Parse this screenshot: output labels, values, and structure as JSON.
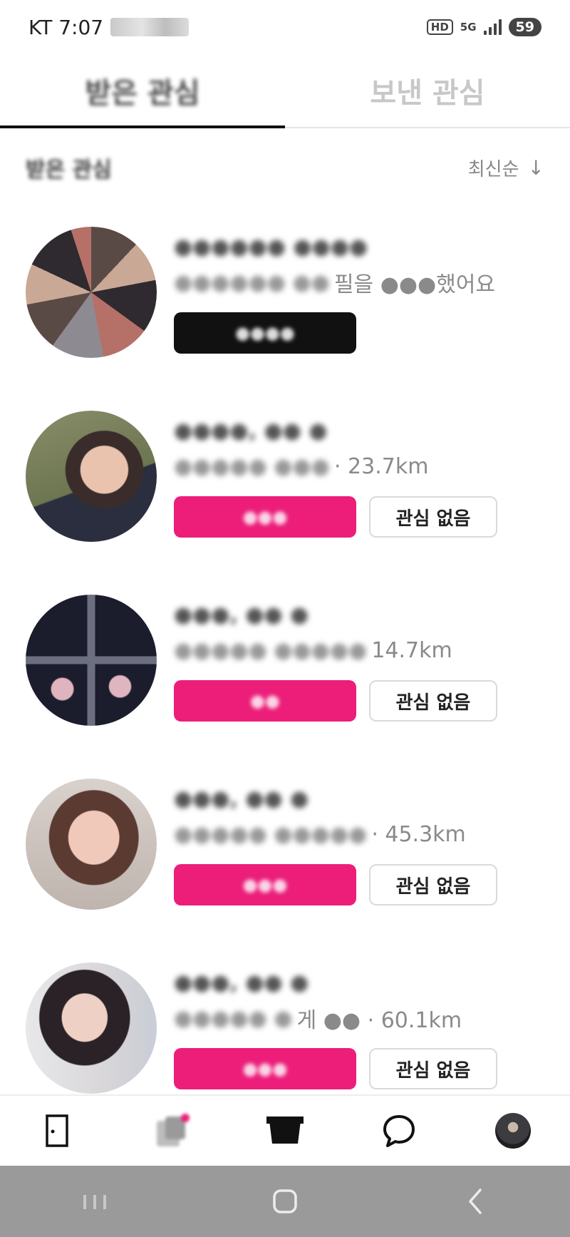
{
  "status_bar": {
    "carrier": "KT 7:07",
    "indicators": [
      "HD",
      "5G"
    ],
    "battery": "59"
  },
  "tabs": [
    {
      "label": "받은 관심",
      "active": true
    },
    {
      "label": "보낸 관심",
      "active": false
    }
  ],
  "list_header": {
    "title": "받은 관심",
    "sort_label": "최신순",
    "sort_icon": "arrow-down-icon"
  },
  "cards": [
    {
      "name": "●●●●●● ●●●●",
      "subtitle_masked": "●●●●●● ●●",
      "subtitle_suffix": "필을 ●●●했어요",
      "primary_button": "●●●●",
      "primary_style": "dark",
      "secondary_button": ""
    },
    {
      "name": "●●●●, ●● ●",
      "subtitle_masked": "●●●●● ●●●",
      "subtitle_suffix": "· 23.7km",
      "primary_button": "●●●",
      "primary_style": "pink",
      "secondary_button": "관심 없음"
    },
    {
      "name": "●●●, ●● ●",
      "subtitle_masked": "●●●●● ●●●●●",
      "subtitle_suffix": "14.7km",
      "primary_button": "●●",
      "primary_style": "pink",
      "secondary_button": "관심 없음"
    },
    {
      "name": "●●●, ●● ●",
      "subtitle_masked": "●●●●● ●●●●●",
      "subtitle_suffix": "· 45.3km",
      "primary_button": "●●●",
      "primary_style": "pink",
      "secondary_button": "관심 없음"
    },
    {
      "name": "●●●, ●● ●",
      "subtitle_masked": "●●●●● ●",
      "subtitle_suffix": "게 ●● · 60.1km",
      "primary_button": "●●●",
      "primary_style": "pink",
      "secondary_button": "관심 없음"
    }
  ],
  "bottom_nav": [
    {
      "icon": "door-icon"
    },
    {
      "icon": "cards-icon"
    },
    {
      "icon": "box-icon"
    },
    {
      "icon": "chat-bubble-icon"
    },
    {
      "icon": "profile-avatar"
    }
  ],
  "system_nav": [
    {
      "icon": "recent-apps-icon"
    },
    {
      "icon": "home-icon"
    },
    {
      "icon": "back-icon"
    }
  ],
  "colors": {
    "accent_pink": "#ec1e79",
    "dark_button": "#111111",
    "system_nav_bg": "#9a9a9a"
  }
}
